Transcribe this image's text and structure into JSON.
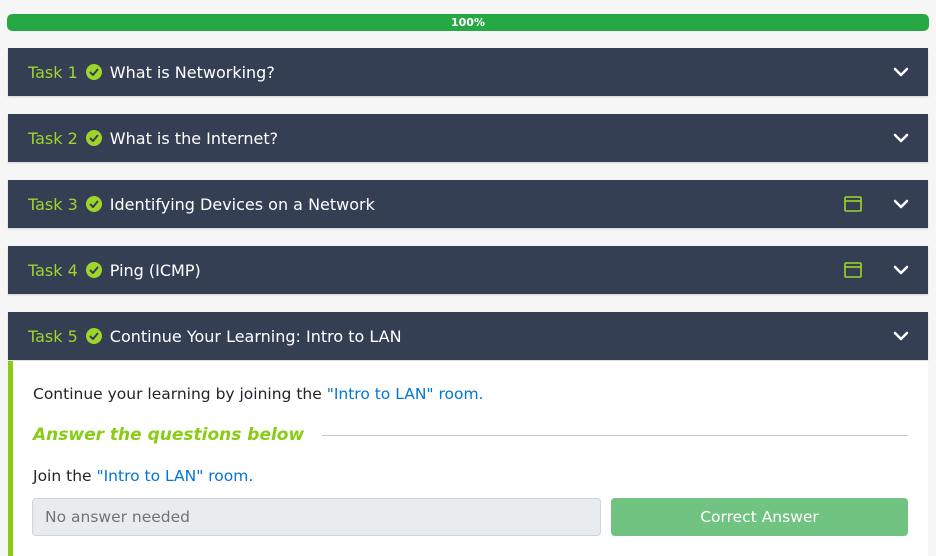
{
  "progress": {
    "label": "100%",
    "value": 100
  },
  "tasks": [
    {
      "number": "Task 1",
      "title": "What is Networking?",
      "has_browser_icon": false,
      "expanded": false
    },
    {
      "number": "Task 2",
      "title": "What is the Internet?",
      "has_browser_icon": false,
      "expanded": false
    },
    {
      "number": "Task 3",
      "title": "Identifying Devices on a Network",
      "has_browser_icon": true,
      "expanded": false
    },
    {
      "number": "Task 4",
      "title": "Ping (ICMP)",
      "has_browser_icon": true,
      "expanded": false
    },
    {
      "number": "Task 5",
      "title": "Continue Your Learning: Intro to LAN",
      "has_browser_icon": false,
      "expanded": true
    }
  ],
  "task5_content": {
    "intro_prefix": "Continue your learning by joining the ",
    "intro_link": "\"Intro to LAN\" room.",
    "answer_heading": "Answer the questions below",
    "question_prefix": "Join the ",
    "question_link": "\"Intro to LAN\" room.",
    "answer_placeholder": "No answer needed",
    "answer_button": "Correct Answer"
  },
  "colors": {
    "task_bg": "#353f54",
    "accent_green": "#9fd52b",
    "progress_green": "#28a745",
    "link_blue": "#0275d8",
    "correct_button": "#70c380"
  },
  "icons": {
    "check": "check-circle-icon",
    "browser": "browser-window-icon",
    "chevron": "chevron-down-icon"
  }
}
